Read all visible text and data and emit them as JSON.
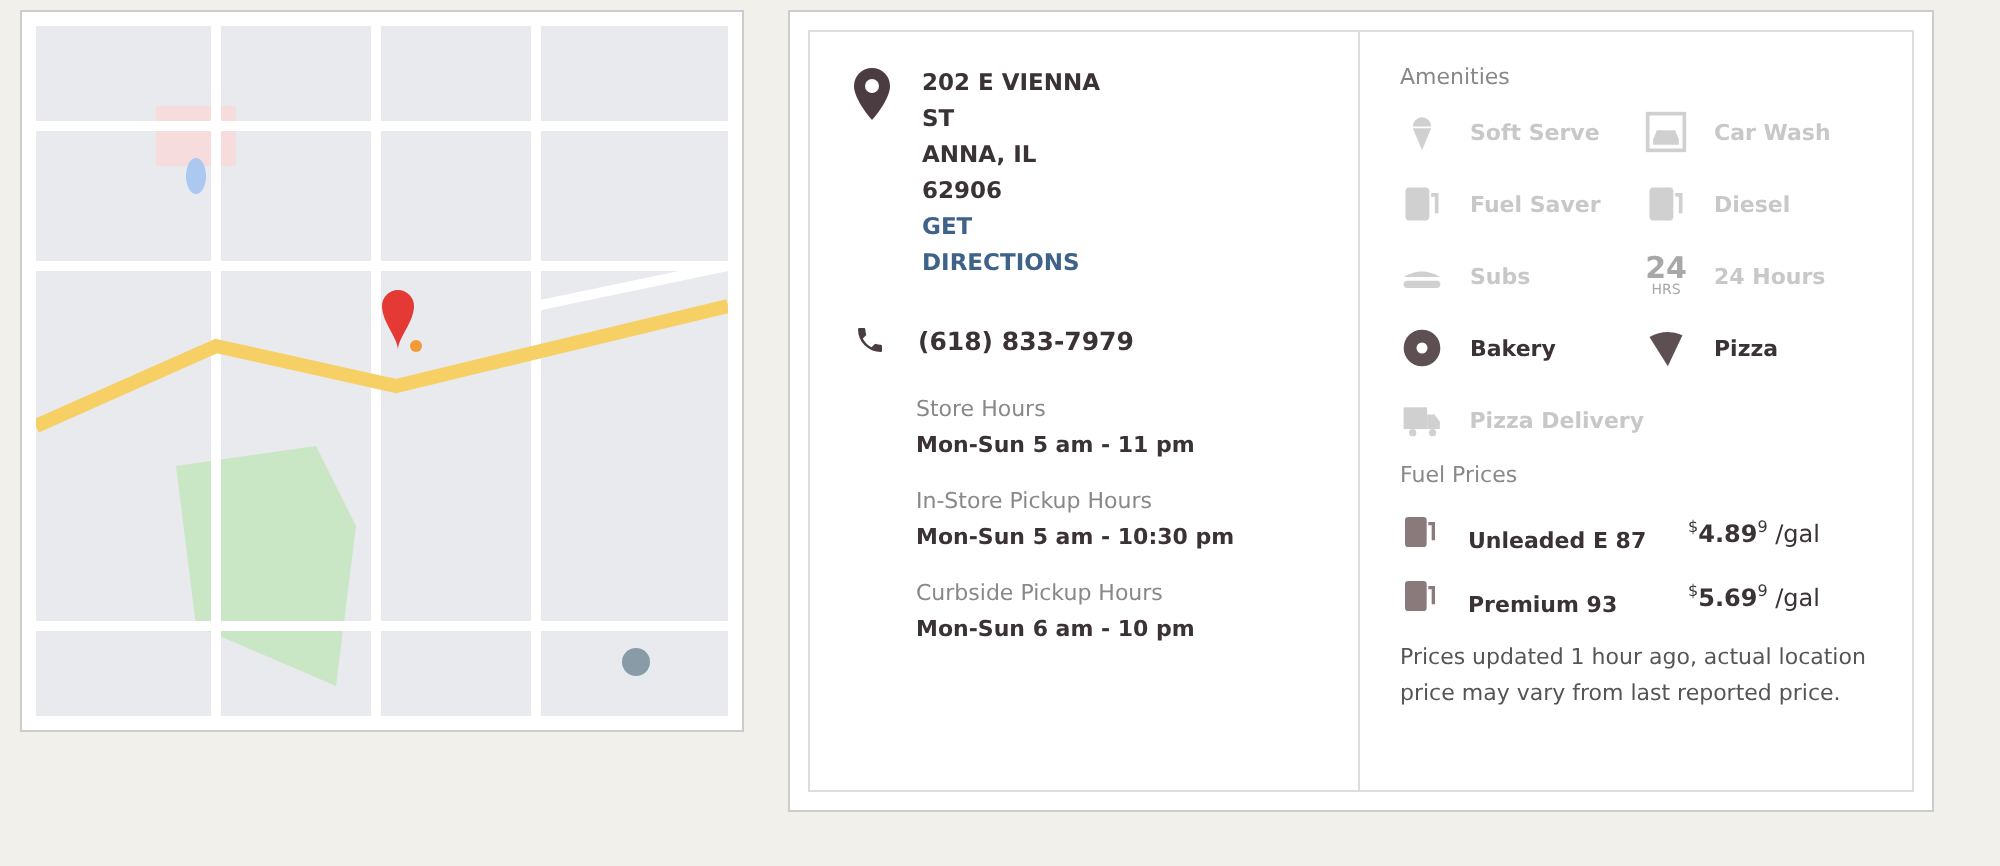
{
  "address": {
    "lines": [
      "202 E VIENNA ST",
      "ANNA,  IL",
      "62906"
    ],
    "directions_link": "GET DIRECTIONS"
  },
  "phone": "(618) 833-7979",
  "hours": [
    {
      "label": "Store Hours",
      "value": "Mon-Sun 5 am - 11 pm"
    },
    {
      "label": "In-Store Pickup Hours",
      "value": "Mon-Sun 5 am - 10:30 pm"
    },
    {
      "label": "Curbside Pickup Hours",
      "value": "Mon-Sun 6 am - 10 pm"
    }
  ],
  "amenities_title": "Amenities",
  "amenities": [
    {
      "kind": "soft-serve",
      "label": "Soft Serve",
      "available": false
    },
    {
      "kind": "car-wash",
      "label": "Car Wash",
      "available": false
    },
    {
      "kind": "fuel-saver",
      "label": "Fuel Saver",
      "available": false
    },
    {
      "kind": "diesel",
      "label": "Diesel",
      "available": false
    },
    {
      "kind": "subs",
      "label": "Subs",
      "available": false
    },
    {
      "kind": "hours",
      "label": "24 Hours",
      "available": false,
      "icon_text": "24",
      "icon_subtext": "HRS"
    },
    {
      "kind": "bakery",
      "label": "Bakery",
      "available": true
    },
    {
      "kind": "pizza",
      "label": "Pizza",
      "available": true
    },
    {
      "kind": "pizza-delivery",
      "label": "Pizza Delivery",
      "available": false
    }
  ],
  "fuel_title": "Fuel Prices",
  "fuel_prices": [
    {
      "name": "Unleaded E 87",
      "currency": "$",
      "amount": "4.89",
      "tenth": "9",
      "unit": "/gal"
    },
    {
      "name": "Premium 93",
      "currency": "$",
      "amount": "5.69",
      "tenth": "9",
      "unit": "/gal"
    }
  ],
  "note": "Prices updated 1 hour ago, actual location price may vary from last reported price."
}
